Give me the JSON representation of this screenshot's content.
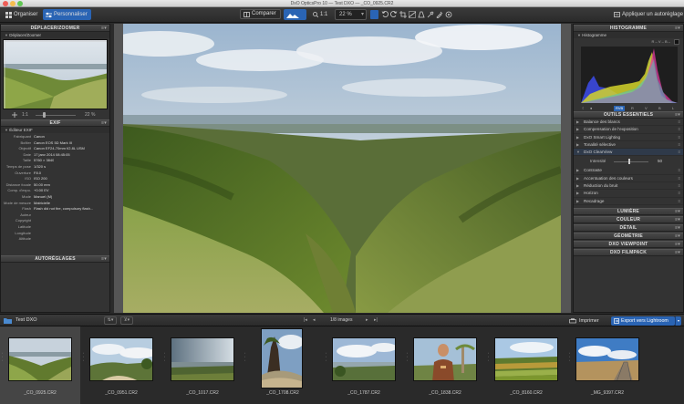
{
  "window": {
    "title": "DxO OpticsPro 10 — Test DXO — _CO_0925.CR2"
  },
  "toolbar": {
    "organiser": "Organiser",
    "personnaliser": "Personnaliser",
    "comparer": "Comparer",
    "ratio": "1:1",
    "zoom": "22 %",
    "auto_apply": "Appliquer un autoréglage"
  },
  "left": {
    "nav_title": "DÉPLACER/ZOOMER",
    "nav_sub": "Déplacer/Zoomer",
    "nav_ratio": "1:1",
    "nav_zoom": "22 %",
    "exif_title": "EXIF",
    "exif_sub": "Éditeur EXIF",
    "exif": [
      {
        "k": "Fabriquant",
        "v": "Canon"
      },
      {
        "k": "Boîtier",
        "v": "Canon EOS 5D Mark III"
      },
      {
        "k": "Objectif",
        "v": "Canon EF24-70mm f/2.8L USM"
      },
      {
        "k": "Date",
        "v": "17 janv 2014 08:45:05"
      },
      {
        "k": "Taille",
        "v": "5760 × 3840"
      },
      {
        "k": "Temps de pose",
        "v": "1/320 s"
      },
      {
        "k": "Ouverture",
        "v": "F8.0"
      },
      {
        "k": "ISO",
        "v": "ISO 200"
      },
      {
        "k": "Distance focale",
        "v": "50.00 mm"
      },
      {
        "k": "Comp. d'expo.",
        "v": "+0.00 EV"
      },
      {
        "k": "Mode",
        "v": "Manuel (M)"
      },
      {
        "k": "Mode de mesure",
        "v": "Matricielle"
      },
      {
        "k": "Flash",
        "v": "Flash did not fire, compulsory flash..."
      },
      {
        "k": "Auteur",
        "v": ""
      },
      {
        "k": "Copyright",
        "v": ""
      },
      {
        "k": "Latitude",
        "v": ""
      },
      {
        "k": "Longitude",
        "v": ""
      },
      {
        "k": "Altitude",
        "v": ""
      }
    ],
    "auto_title": "AUTORÉGLAGES"
  },
  "right": {
    "histo_title": "HISTOGRAMME",
    "histo_sub": "Histogramme",
    "histo_readout": "R – V – B –",
    "histo_channels": [
      "RVB",
      "R",
      "V",
      "B",
      "L"
    ],
    "tools_title": "OUTILS ESSENTIELS",
    "tools": [
      "Balance des blancs",
      "Compensation de l'exposition",
      "DxO Smart Lighting",
      "Tonalité sélective",
      "DxO ClearView"
    ],
    "intensity_label": "Intensité",
    "intensity_value": "50",
    "tools2": [
      "Contraste",
      "Accentuation des couleurs",
      "Réduction du bruit",
      "Horizon",
      "Recadrage"
    ],
    "sections": [
      "LUMIÈRE",
      "COULEUR",
      "DÉTAIL",
      "GÉOMÉTRIE",
      "DXO VIEWPOINT",
      "DXO FILMPACK"
    ]
  },
  "filmbar": {
    "folder": "Test DXO",
    "count": "1/8 images",
    "print": "Imprimer",
    "export": "Export vers Lightroom"
  },
  "thumbs": [
    "_CO_0925.CR2",
    "_CO_0951.CR2",
    "_CO_1017.CR2",
    "_CO_1708.CR2",
    "_CO_1787.CR2",
    "_CO_1838.CR2",
    "_CO_8160.CR2",
    "_MG_9397.CR2"
  ],
  "colors": {
    "accent": "#2a64b4",
    "panel": "#333333",
    "background": "#2b2b2b"
  }
}
